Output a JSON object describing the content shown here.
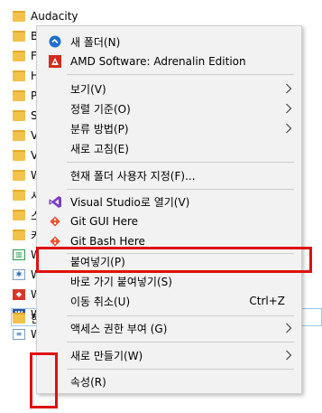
{
  "files": [
    {
      "name": "Audacity",
      "icon": "folder"
    },
    {
      "name": "B",
      "icon": "folder"
    },
    {
      "name": "F",
      "icon": "folder"
    },
    {
      "name": "H",
      "icon": "folder"
    },
    {
      "name": "P",
      "icon": "folder"
    },
    {
      "name": "S",
      "icon": "folder"
    },
    {
      "name": "V",
      "icon": "folder"
    },
    {
      "name": "V",
      "icon": "folder"
    },
    {
      "name": "W",
      "icon": "folder"
    },
    {
      "name": "시",
      "icon": "folder"
    },
    {
      "name": "스",
      "icon": "folder"
    },
    {
      "name": "카",
      "icon": "folder"
    },
    {
      "name": "W",
      "icon": "chart-app"
    },
    {
      "name": "W",
      "icon": "app"
    },
    {
      "name": "W",
      "icon": "red-app"
    },
    {
      "name": "W",
      "icon": "word-doc"
    },
    {
      "name": "W",
      "icon": "doc"
    },
    {
      "name": "한",
      "icon": "folder"
    }
  ],
  "menu": {
    "new_folder": "새 폴더(N)",
    "amd": "AMD Software: Adrenalin Edition",
    "view": "보기(V)",
    "sort": "정렬 기준(O)",
    "group": "분류 방법(P)",
    "refresh": "새로 고침(E)",
    "customize": "현재 폴더 사용자 지정(F)...",
    "vs": "Visual Studio로 열기(V)",
    "git_gui": "Git GUI Here",
    "git_bash": "Git Bash Here",
    "paste": "붙여넣기(P)",
    "paste_shortcut": "바로 가기 붙여넣기(S)",
    "undo_move": "이동 취소(U)",
    "undo_shortcut": "Ctrl+Z",
    "access": "액세스 권한 부여 (G)",
    "new": "새로 만들기(W)",
    "properties": "속성(R)"
  },
  "colors": {
    "highlight": "#e01010",
    "menu_bg": "#f2f2f2",
    "folder": "#f3c24b"
  }
}
